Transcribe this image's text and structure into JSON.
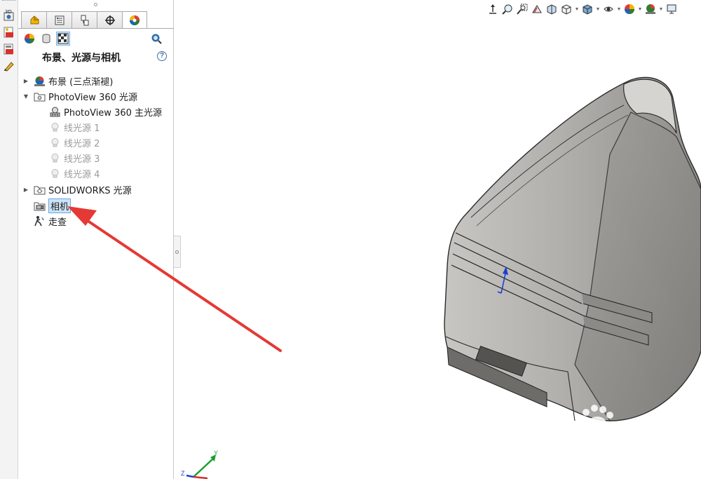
{
  "left_strip": {
    "items": [
      {
        "icon": "3d-view-icon",
        "label": "3D"
      },
      {
        "icon": "render-tools-icon",
        "label": ""
      },
      {
        "icon": "render-queue-icon",
        "label": ""
      },
      {
        "icon": "edit-appearance-icon",
        "label": ""
      }
    ]
  },
  "panel": {
    "tabs": [
      {
        "icon": "feature-manager-icon",
        "active": false
      },
      {
        "icon": "property-manager-icon",
        "active": false
      },
      {
        "icon": "configuration-manager-icon",
        "active": false
      },
      {
        "icon": "dimxpert-icon",
        "active": false
      },
      {
        "icon": "display-manager-icon",
        "active": true
      }
    ],
    "subtoolbar": [
      "appearances-icon",
      "decals-icon",
      "scenes-lights-cameras-icon"
    ],
    "title": "布景、光源与相机",
    "help": "?"
  },
  "tree": [
    {
      "label": "布景 (三点渐褪)",
      "icon": "scene-icon",
      "expander": "collapsed",
      "indent": 0,
      "dim": false,
      "selected": false
    },
    {
      "label": "PhotoView 360 光源",
      "icon": "photoview-lights-folder-icon",
      "expander": "expanded",
      "indent": 0,
      "dim": false,
      "selected": false
    },
    {
      "label": "PhotoView 360 主光源",
      "icon": "primary-light-icon",
      "expander": "none",
      "indent": 1,
      "dim": false,
      "selected": false
    },
    {
      "label": "线光源 1",
      "icon": "directional-light-icon",
      "expander": "none",
      "indent": 1,
      "dim": true,
      "selected": false
    },
    {
      "label": "线光源 2",
      "icon": "directional-light-icon",
      "expander": "none",
      "indent": 1,
      "dim": true,
      "selected": false
    },
    {
      "label": "线光源 3",
      "icon": "directional-light-icon",
      "expander": "none",
      "indent": 1,
      "dim": true,
      "selected": false
    },
    {
      "label": "线光源 4",
      "icon": "directional-light-icon",
      "expander": "none",
      "indent": 1,
      "dim": true,
      "selected": false
    },
    {
      "label": "SOLIDWORKS 光源",
      "icon": "solidworks-lights-folder-icon",
      "expander": "collapsed",
      "indent": 0,
      "dim": false,
      "selected": false
    },
    {
      "label": "相机",
      "icon": "camera-icon",
      "expander": "none",
      "indent": 0,
      "dim": false,
      "selected": true
    },
    {
      "label": "走查",
      "icon": "walkthrough-icon",
      "expander": "none",
      "indent": 0,
      "dim": false,
      "selected": false
    }
  ],
  "hud_toolbar": [
    "view-orientation-triad-icon",
    "zoom-to-fit-icon",
    "zoom-to-area-icon",
    "previous-view-icon",
    "section-view-icon",
    "dynamic-annotation-icon",
    "view-orientation-icon",
    "display-style-icon",
    "hide-show-items-icon",
    "edit-appearance-icon",
    "apply-scene-icon",
    "view-settings-icon"
  ],
  "triad": {
    "y_label": "Y",
    "z_label": "Z"
  },
  "colors": {
    "accent": "#e53935",
    "selection": "#cde4f7",
    "model": "#a9a7a3"
  }
}
